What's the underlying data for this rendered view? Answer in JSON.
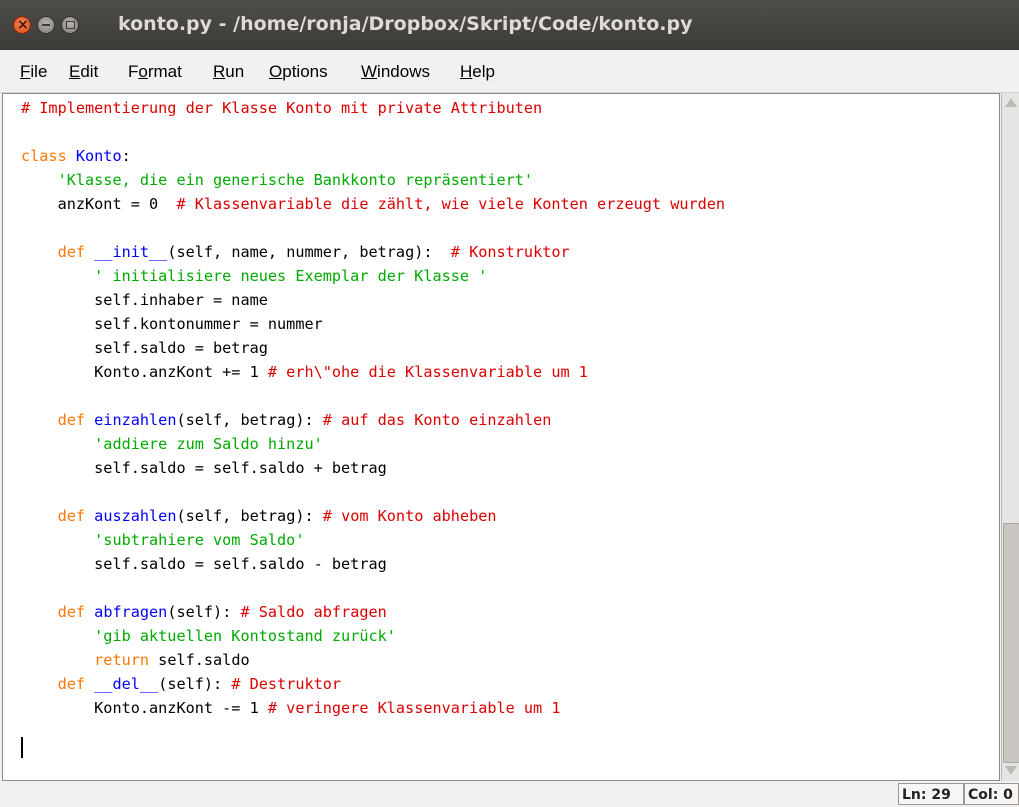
{
  "window": {
    "title": "konto.py - /home/ronja/Dropbox/Skript/Code/konto.py",
    "close_glyph": "×"
  },
  "menu": [
    {
      "first": "F",
      "rest": "ile"
    },
    {
      "first": "E",
      "rest": "dit"
    },
    {
      "first": "F",
      "rest": "ormat",
      "prefix": ""
    },
    {
      "first": "R",
      "rest": "un"
    },
    {
      "first": "O",
      "rest": "ptions"
    },
    {
      "first": "W",
      "rest": "indows"
    },
    {
      "first": "H",
      "rest": "elp"
    }
  ],
  "code": {
    "l1": "# Implementierung der Klasse Konto mit private Attributen",
    "l3_kw": "class",
    "l3_name": "Konto",
    "l3_rest": ":",
    "l4": "'Klasse, die ein generische Bankkonto repräsentiert'",
    "l5_code": "anzKont = 0  ",
    "l5_cmt": "# Klassenvariable die zählt, wie viele Konten erzeugt wurden",
    "l7_kw": "def",
    "l7_name": "__init__",
    "l7_rest": "(self, name, nummer, betrag):  ",
    "l7_cmt": "# Konstruktor",
    "l8": "' initialisiere neues Exemplar der Klasse '",
    "l9": "self.inhaber = name",
    "l10": "self.kontonummer = nummer",
    "l11": "self.saldo = betrag",
    "l12_code": "Konto.anzKont += 1 ",
    "l12_cmt": "# erh\\\"ohe die Klassenvariable um 1",
    "l14_kw": "def",
    "l14_name": "einzahlen",
    "l14_rest": "(self, betrag): ",
    "l14_cmt": "# auf das Konto einzahlen",
    "l15": "'addiere zum Saldo hinzu'",
    "l16": "self.saldo = self.saldo + betrag",
    "l18_kw": "def",
    "l18_name": "auszahlen",
    "l18_rest": "(self, betrag): ",
    "l18_cmt": "# vom Konto abheben",
    "l19": "'subtrahiere vom Saldo'",
    "l20": "self.saldo = self.saldo - betrag",
    "l22_kw": "def",
    "l22_name": "abfragen",
    "l22_rest": "(self): ",
    "l22_cmt": "# Saldo abfragen",
    "l23": "'gib aktuellen Kontostand zurück'",
    "l24_kw": "return",
    "l24_rest": " self.saldo",
    "l26_kw": "def",
    "l26_name": "__del__",
    "l26_rest": "(self): ",
    "l26_cmt": "# Destruktor",
    "l27_code": "Konto.anzKont -= 1 ",
    "l27_cmt": "# veringere Klassenvariable um 1"
  },
  "status": {
    "line": "Ln: 29",
    "col": "Col: 0"
  },
  "colors": {
    "keyword": "#ff7700",
    "definition": "#0000ff",
    "string": "#00aa00",
    "comment": "#dd0000"
  }
}
